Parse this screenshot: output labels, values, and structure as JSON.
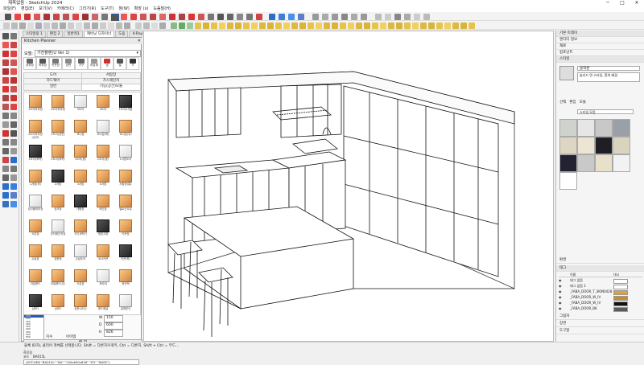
{
  "window": {
    "title": "제목없음 - SketchUp 2024",
    "controls": [
      "─",
      "□",
      "✕"
    ]
  },
  "menu": [
    "파일(F)",
    "편집(E)",
    "보기(V)",
    "카메라(C)",
    "그리기(R)",
    "도구(T)",
    "창(W)",
    "확장 (x)",
    "도움말(H)"
  ],
  "tabs": [
    "스타일링 1",
    "편집 2",
    "일반적1",
    "캐비닛 디자이너",
    "도움",
    "X-Ray"
  ],
  "planner": {
    "title": "Kitchen Planner",
    "close": "✕",
    "product_label": "모델:",
    "product_value": "가전플랜(U Ver 1)",
    "categories": [
      "상부장",
      "하부장",
      "키큰장",
      "상판",
      "가구",
      "마감재",
      "냉",
      "빌",
      "가"
    ],
    "subtabs": [
      [
        "도어",
        "서랍장"
      ],
      [
        "하드웨어",
        "가스레인지",
        "액세서리"
      ],
      [
        "일반",
        "시스템",
        "도구",
        "마감",
        "기능(공간)모듈"
      ]
    ],
    "items": [
      [
        "1도어하부장",
        "2도어하부장",
        "3도어",
        "4도어",
        "1도어2서랍"
      ],
      [
        "2도어하부장(싱크)",
        "2도어(상판)",
        "코너장",
        "코너장(좌)",
        "코너장(우)"
      ],
      [
        "1도어(좌측)",
        "2도어(좌측)",
        "1도어(중)",
        "2도어(중)",
        "1서랍도어"
      ],
      [
        "1서랍(하)",
        "2서랍",
        "3서랍",
        "4서랍",
        "서랍장(통)"
      ],
      [
        "싱크볼하부장",
        "싱크장",
        "대형장",
        "와인장",
        "빌트인오븐"
      ],
      [
        "오븐장",
        "전자레인지장",
        "식기세척기",
        "냉장고장",
        "키큰장"
      ],
      [
        "수납장",
        "양문장",
        "수납도어",
        "코너키큰",
        "키큰(좌)"
      ],
      [
        "아일랜드",
        "아일랜드(우)",
        "오픈장",
        "조리대",
        "와인랙"
      ],
      [
        "상판1",
        "상판2",
        "상판(코너)",
        "엔드패널",
        "걸레받이"
      ]
    ],
    "sizes": [
      "150",
      "200",
      "250",
      "300",
      "350",
      "400",
      "450",
      "500",
      "550",
      "600",
      "650",
      "700",
      "750",
      "800",
      "850",
      "900"
    ],
    "selected_size": "150",
    "dims": {
      "w_label": "W",
      "w": "150",
      "d_label": "D",
      "d": "600",
      "h_label": "H",
      "h": "826"
    },
    "radio": [
      "치수",
      "아이템"
    ],
    "place_button": "배 치",
    "info": {
      "label_type": "종류",
      "type_val": "하부장",
      "label_code": "코드",
      "code_val": "BA015L",
      "note": "(KITCHEN \"BA015L\" \"BA\" \"150x600x826\" \"PO\" \"BASE\")"
    }
  },
  "tray": {
    "title": "기본 트레이",
    "sections_top": [
      "엔티티 정보",
      "재료",
      "컴포넌트",
      "스타일"
    ],
    "style": {
      "name": "블랙판",
      "desc": "솔리드 면 스타일, 흰색 배경.",
      "tabs": [
        "선택",
        "편집",
        "모듈"
      ],
      "dropdown": "스타일 모음"
    },
    "layers": {
      "title": "태그",
      "col_name": "이름",
      "col_dash": "대시",
      "rows": [
        {
          "name": "태그 없음",
          "dash": "기본값",
          "color": "#ffffff"
        },
        {
          "name": "태그 없음 1",
          "dash": "기본값",
          "color": "#ffffff"
        },
        {
          "name": "_FABA_DOOR_T_SKIN0428",
          "dash": "기본값",
          "color": "#d7a33a"
        },
        {
          "name": "_FABA_DOOR_W_IV",
          "dash": "기본값",
          "color": "#c48d34"
        },
        {
          "name": "_FABA_DOOR_W_IV",
          "dash": "기본값",
          "color": "#111111"
        },
        {
          "name": "_FABA_DOOR_BK",
          "dash": "기본값",
          "color": "#5a5a5a"
        }
      ]
    },
    "sections_bottom": [
      "그림자",
      "장면",
      "도구함"
    ],
    "section_mid": "환경"
  },
  "status": "물체 ID치L 클리어 객체를 선택합니다. Shift = 다른지우개키, Ctrl = 다른지, Shift + Ctrl = 부드..."
}
